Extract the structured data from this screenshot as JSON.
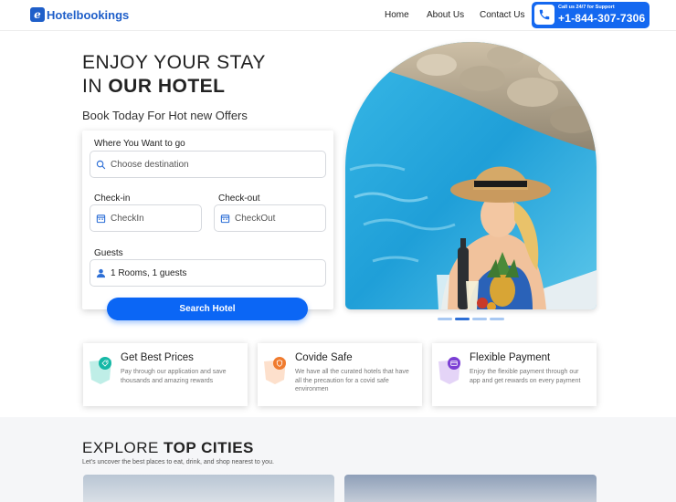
{
  "brand": {
    "logo_mark": "e",
    "name": "Hotelbookings",
    "color": "#1f5fc9"
  },
  "nav": {
    "home": "Home",
    "about": "About Us",
    "contact": "Contact Us"
  },
  "call": {
    "label": "Call us 24/7 for Support",
    "number": "+1-844-307-7306",
    "icon": "phone-icon"
  },
  "hero": {
    "title_line1": "ENJOY YOUR STAY",
    "title_line2_prefix": "IN ",
    "title_line2_bold": "OUR HOTEL",
    "subtitle": "Book Today For Hot new Offers"
  },
  "form": {
    "where_label": "Where You Want to go",
    "where_placeholder": "Choose destination",
    "checkin_label": "Check-in",
    "checkin_placeholder": "CheckIn",
    "checkout_label": "Check-out",
    "checkout_placeholder": "CheckOut",
    "guests_label": "Guests",
    "guests_value": "1 Rooms, 1 guests",
    "search_button": "Search Hotel"
  },
  "carousel": {
    "slides": 4,
    "active": 2
  },
  "features": [
    {
      "title": "Get Best Prices",
      "desc": "Pay through our application and save thousands and amazing rewards",
      "color": "#15b8a6",
      "icon": "tag-icon"
    },
    {
      "title": "Covide Safe",
      "desc": "We have all the curated hotels that have all the precaution for a covid safe environmen",
      "color": "#f07b2e",
      "icon": "shield-icon"
    },
    {
      "title": "Flexible Payment",
      "desc": "Enjoy the flexible payment through our app and get rewards on every payment",
      "color": "#7b3fd4",
      "icon": "payment-icon"
    }
  ],
  "explore": {
    "title_prefix": "EXPLORE ",
    "title_bold": "TOP CITIES",
    "subtitle": "Let's uncover the best places to eat, drink, and shop nearest to you."
  }
}
